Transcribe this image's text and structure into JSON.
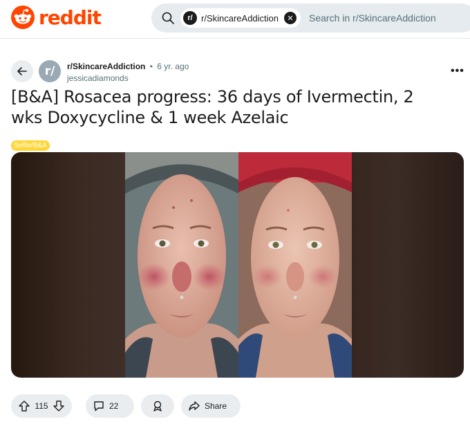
{
  "header": {
    "brand": "reddit",
    "search": {
      "community_chip": "r/SkincareAddiction",
      "chip_avatar": "r/",
      "placeholder": "Search in r/SkincareAddiction"
    }
  },
  "post": {
    "subreddit": "r/SkincareAddiction",
    "subreddit_avatar": "r/",
    "age": "6 yr. ago",
    "separator": "•",
    "author": "jessicadiamonds",
    "more_label": "•••",
    "title": "[B&A] Rosacea progress: 36 days of Ivermectin, 2 wks Doxycycline & 1 week Azelaic",
    "flair": "Selfie/B&A",
    "flair_color": "#ffd635",
    "media": [
      {
        "position": "before",
        "headband": "gray",
        "redness": "high"
      },
      {
        "position": "after",
        "headband": "red",
        "redness": "reduced"
      }
    ]
  },
  "actions": {
    "upvotes": "115",
    "comments": "22",
    "share_label": "Share"
  },
  "colors": {
    "brand": "#ff4500",
    "search_bg": "#e5ebee",
    "pill_bg": "#eaedef",
    "muted_text": "#576f76"
  },
  "icons": [
    "reddit-logo-icon",
    "search-icon",
    "close-icon",
    "back-arrow-icon",
    "upvote-icon",
    "downvote-icon",
    "comment-icon",
    "award-icon",
    "share-icon",
    "more-icon"
  ]
}
